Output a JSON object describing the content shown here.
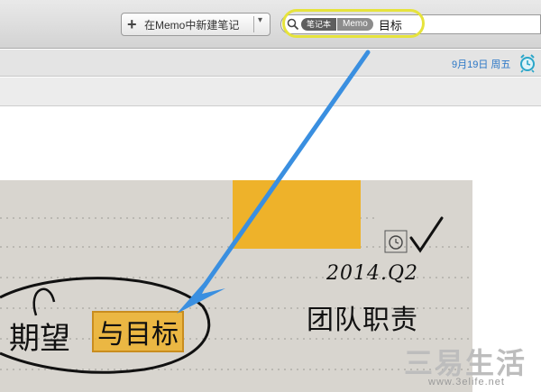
{
  "toolbar": {
    "new_note_label": "在Memo中新建笔记",
    "plus_glyph": "+",
    "caret_glyph": "▾"
  },
  "search": {
    "tokens": [
      "笔记本",
      "Memo"
    ],
    "query": "目标",
    "highlight_color": "#e6e33c"
  },
  "datebar": {
    "date_label": "9月19日 周五",
    "date_color": "#2a76c6",
    "alarm_icon": "alarm-clock-icon"
  },
  "note": {
    "handwriting": {
      "date": "2014.Q2",
      "team": "团队职责",
      "goal_prefix": "期望",
      "goal_highlight": "与目标",
      "highlight_color": "#eeb22a"
    },
    "sticky_color": "#eeb22a"
  },
  "annotation": {
    "arrow_color": "#3a8fe0"
  },
  "watermark": {
    "logo_text": "三易生活",
    "url_text": "www.3elife.net"
  }
}
